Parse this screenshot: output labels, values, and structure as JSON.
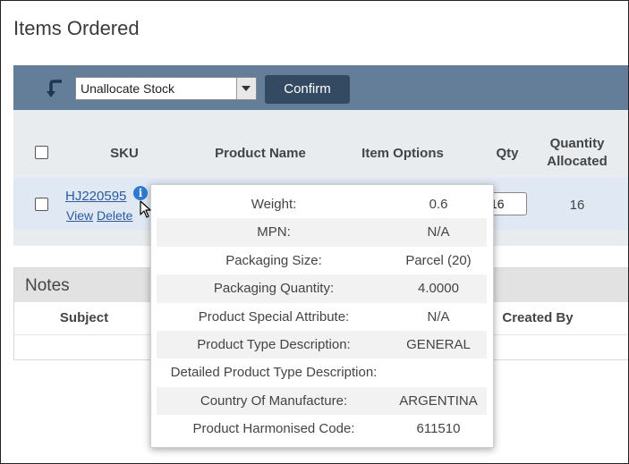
{
  "page": {
    "title": "Items Ordered"
  },
  "toolbar": {
    "action_select_value": "Unallocate Stock",
    "confirm_label": "Confirm"
  },
  "items_table": {
    "columns": {
      "sku": "SKU",
      "product_name": "Product Name",
      "item_options": "Item Options",
      "qty": "Qty",
      "quantity_allocated_line1": "Quantity",
      "quantity_allocated_line2": "Allocated"
    },
    "rows": [
      {
        "sku": "HJ220595",
        "view_label": "View",
        "delete_label": "Delete",
        "qty": "16",
        "quantity_allocated": "16"
      }
    ]
  },
  "notes": {
    "title": "Notes",
    "columns": {
      "subject": "Subject",
      "created_by": "Created By"
    }
  },
  "tooltip": {
    "rows": [
      {
        "label": "Weight:",
        "value": "0.6"
      },
      {
        "label": "MPN:",
        "value": "N/A"
      },
      {
        "label": "Packaging Size:",
        "value": "Parcel (20)"
      },
      {
        "label": "Packaging Quantity:",
        "value": "4.0000"
      },
      {
        "label": "Product Special Attribute:",
        "value": "N/A"
      },
      {
        "label": "Product Type Description:",
        "value": "GENERAL"
      },
      {
        "label": "Detailed Product Type Description:",
        "value": ""
      },
      {
        "label": "Country Of Manufacture:",
        "value": "ARGENTINA"
      },
      {
        "label": "Product Harmonised Code:",
        "value": "611510"
      }
    ]
  },
  "icons": {
    "back": "return-arrow-icon",
    "info": "info-icon",
    "dropdown": "chevron-down-icon",
    "cursor": "mouse-pointer-icon"
  },
  "colors": {
    "toolbar": "#647d99",
    "confirm_button": "#344a63",
    "link": "#2a5b9c",
    "info_icon": "#2f7ad1"
  }
}
